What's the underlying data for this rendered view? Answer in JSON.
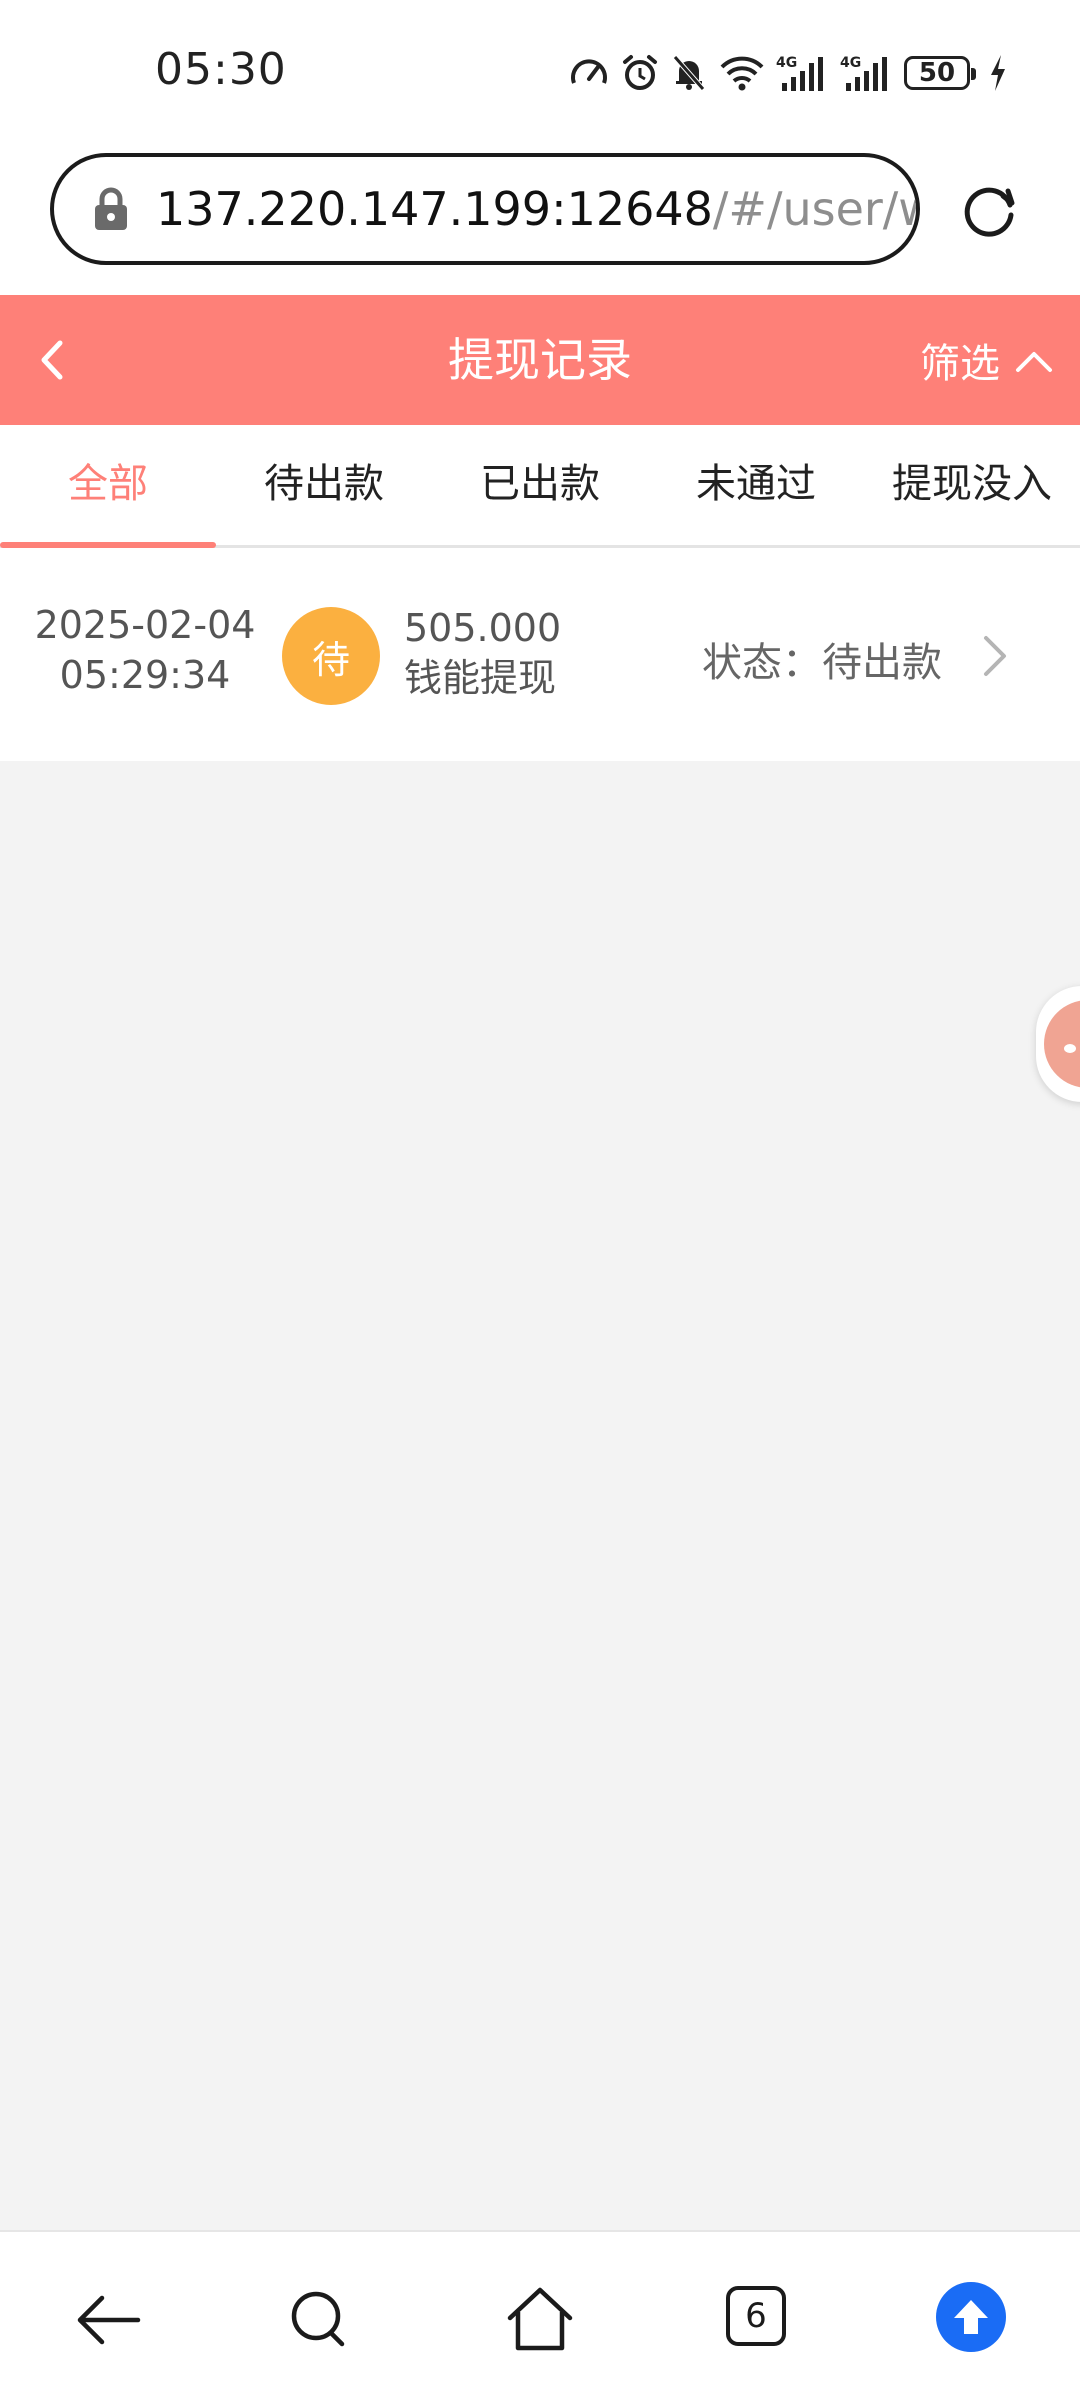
{
  "status_bar": {
    "time": "05:30",
    "battery": "50"
  },
  "browser": {
    "url_host": "137.220.147.199:12648",
    "url_path": "/#/user/wit"
  },
  "header": {
    "title": "提现记录",
    "filter_label": "筛选"
  },
  "tabs": [
    {
      "label": "全部",
      "active": true
    },
    {
      "label": "待出款",
      "active": false
    },
    {
      "label": "已出款",
      "active": false
    },
    {
      "label": "未通过",
      "active": false
    },
    {
      "label": "提现没入",
      "active": false
    }
  ],
  "records": [
    {
      "date": "2025-02-04",
      "time": "05:29:34",
      "badge": "待",
      "amount": "505.000",
      "type": "钱能提现",
      "status": "状态：待出款"
    }
  ],
  "bottom_nav": {
    "tab_count": "6"
  },
  "colors": {
    "accent": "#fe8078",
    "badge": "#fbb040",
    "upload": "#1a6cf5"
  }
}
